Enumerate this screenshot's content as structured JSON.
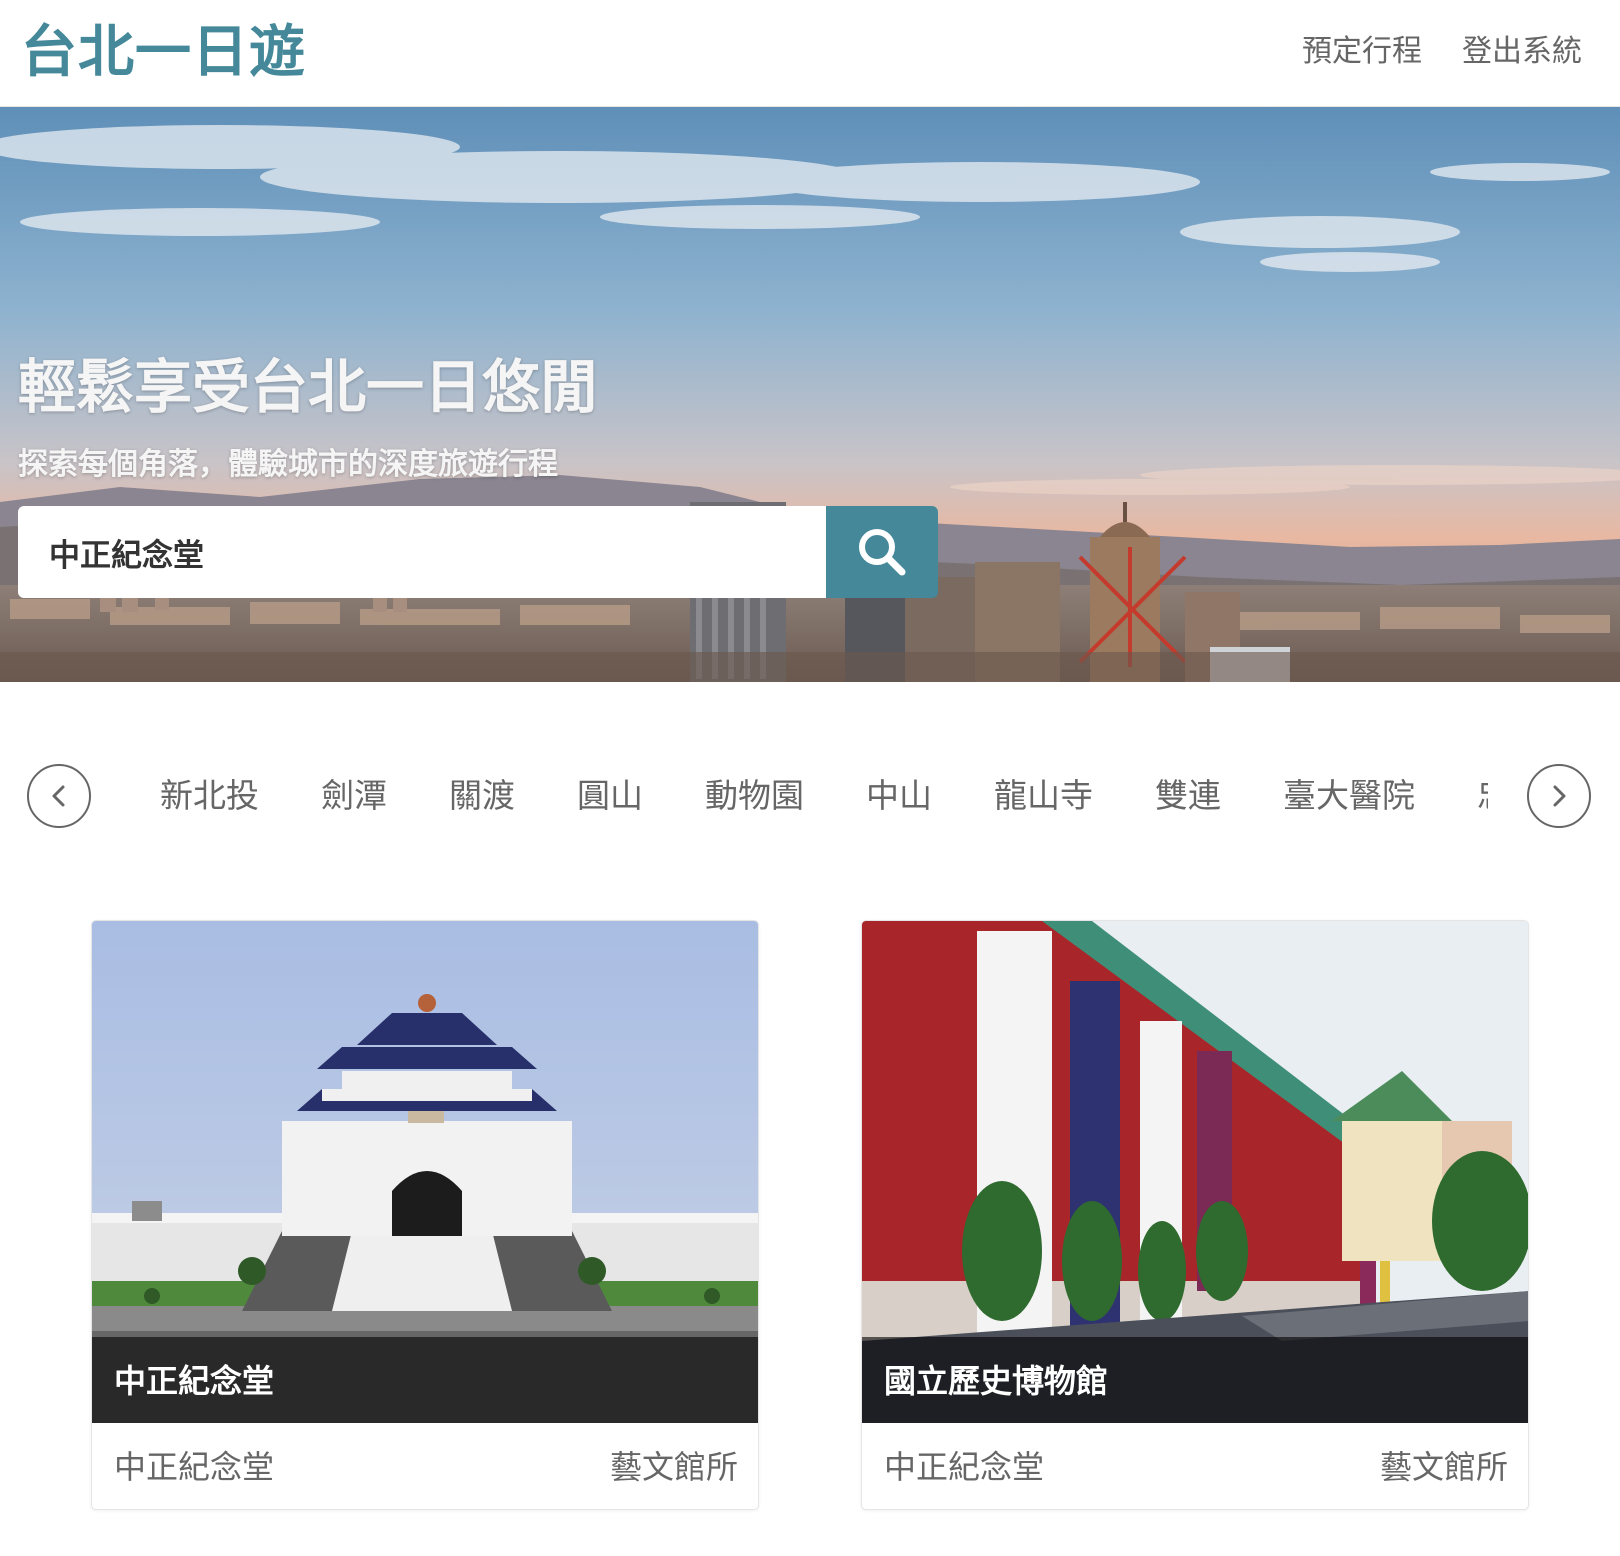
{
  "header": {
    "logo": "台北一日遊",
    "nav": [
      {
        "label": "預定行程"
      },
      {
        "label": "登出系統"
      }
    ]
  },
  "hero": {
    "title": "輕鬆享受台北一日悠閒",
    "subtitle": "探索每個角落，體驗城市的深度旅遊行程",
    "search": {
      "value": "中正紀念堂",
      "button_icon": "search-icon"
    }
  },
  "categories": {
    "left_icon": "chevron-left-icon",
    "right_icon": "chevron-right-icon",
    "items": [
      {
        "label": "新北投"
      },
      {
        "label": "劍潭"
      },
      {
        "label": "關渡"
      },
      {
        "label": "圓山"
      },
      {
        "label": "動物園"
      },
      {
        "label": "中山"
      },
      {
        "label": "龍山寺"
      },
      {
        "label": "雙連"
      },
      {
        "label": "臺大醫院"
      },
      {
        "label": "忠孝"
      }
    ]
  },
  "attractions": [
    {
      "name": "中正紀念堂",
      "mrt": "中正紀念堂",
      "category": "藝文館所"
    },
    {
      "name": "國立歷史博物館",
      "mrt": "中正紀念堂",
      "category": "藝文館所"
    }
  ],
  "colors": {
    "brand": "#448899",
    "text": "#666666",
    "white": "#ffffff"
  }
}
